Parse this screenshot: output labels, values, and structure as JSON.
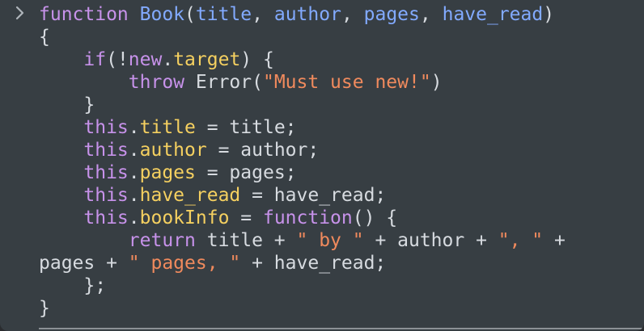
{
  "console": {
    "lines": [
      [
        {
          "c": "k",
          "t": "function"
        },
        {
          "c": "p",
          "t": " "
        },
        {
          "c": "f",
          "t": "Book"
        },
        {
          "c": "p",
          "t": "("
        },
        {
          "c": "f",
          "t": "title"
        },
        {
          "c": "p",
          "t": ", "
        },
        {
          "c": "f",
          "t": "author"
        },
        {
          "c": "p",
          "t": ", "
        },
        {
          "c": "f",
          "t": "pages"
        },
        {
          "c": "p",
          "t": ", "
        },
        {
          "c": "f",
          "t": "have_read"
        },
        {
          "c": "p",
          "t": ")"
        }
      ],
      [
        {
          "c": "p",
          "t": "{"
        }
      ],
      [
        {
          "c": "p",
          "t": "    "
        },
        {
          "c": "k",
          "t": "if"
        },
        {
          "c": "p",
          "t": "(!"
        },
        {
          "c": "k",
          "t": "new"
        },
        {
          "c": "p",
          "t": "."
        },
        {
          "c": "t",
          "t": "target"
        },
        {
          "c": "p",
          "t": ") {"
        }
      ],
      [
        {
          "c": "p",
          "t": "        "
        },
        {
          "c": "k",
          "t": "throw"
        },
        {
          "c": "p",
          "t": " Error("
        },
        {
          "c": "s",
          "t": "\"Must use new!\""
        },
        {
          "c": "p",
          "t": ")"
        }
      ],
      [
        {
          "c": "p",
          "t": "    }"
        }
      ],
      [
        {
          "c": "p",
          "t": "    "
        },
        {
          "c": "k",
          "t": "this"
        },
        {
          "c": "p",
          "t": "."
        },
        {
          "c": "t",
          "t": "title"
        },
        {
          "c": "p",
          "t": " = title;"
        }
      ],
      [
        {
          "c": "p",
          "t": "    "
        },
        {
          "c": "k",
          "t": "this"
        },
        {
          "c": "p",
          "t": "."
        },
        {
          "c": "t",
          "t": "author"
        },
        {
          "c": "p",
          "t": " = author;"
        }
      ],
      [
        {
          "c": "p",
          "t": "    "
        },
        {
          "c": "k",
          "t": "this"
        },
        {
          "c": "p",
          "t": "."
        },
        {
          "c": "t",
          "t": "pages"
        },
        {
          "c": "p",
          "t": " = pages;"
        }
      ],
      [
        {
          "c": "p",
          "t": "    "
        },
        {
          "c": "k",
          "t": "this"
        },
        {
          "c": "p",
          "t": "."
        },
        {
          "c": "t",
          "t": "have_read"
        },
        {
          "c": "p",
          "t": " = have_read;"
        }
      ],
      [
        {
          "c": "p",
          "t": "    "
        },
        {
          "c": "k",
          "t": "this"
        },
        {
          "c": "p",
          "t": "."
        },
        {
          "c": "t",
          "t": "bookInfo"
        },
        {
          "c": "p",
          "t": " = "
        },
        {
          "c": "k",
          "t": "function"
        },
        {
          "c": "p",
          "t": "() {"
        }
      ],
      [
        {
          "c": "p",
          "t": "        "
        },
        {
          "c": "k",
          "t": "return"
        },
        {
          "c": "p",
          "t": " title + "
        },
        {
          "c": "s",
          "t": "\" by \""
        },
        {
          "c": "p",
          "t": " + author + "
        },
        {
          "c": "s",
          "t": "\", \""
        },
        {
          "c": "p",
          "t": " +"
        }
      ],
      [
        {
          "c": "p",
          "t": "pages + "
        },
        {
          "c": "s",
          "t": "\" pages, \""
        },
        {
          "c": "p",
          "t": " + have_read;"
        }
      ],
      [
        {
          "c": "p",
          "t": "    };"
        }
      ],
      [
        {
          "c": "p",
          "t": "}"
        }
      ]
    ]
  },
  "prompt": {
    "glyph": "›",
    "icon": "chevron-right-icon"
  }
}
